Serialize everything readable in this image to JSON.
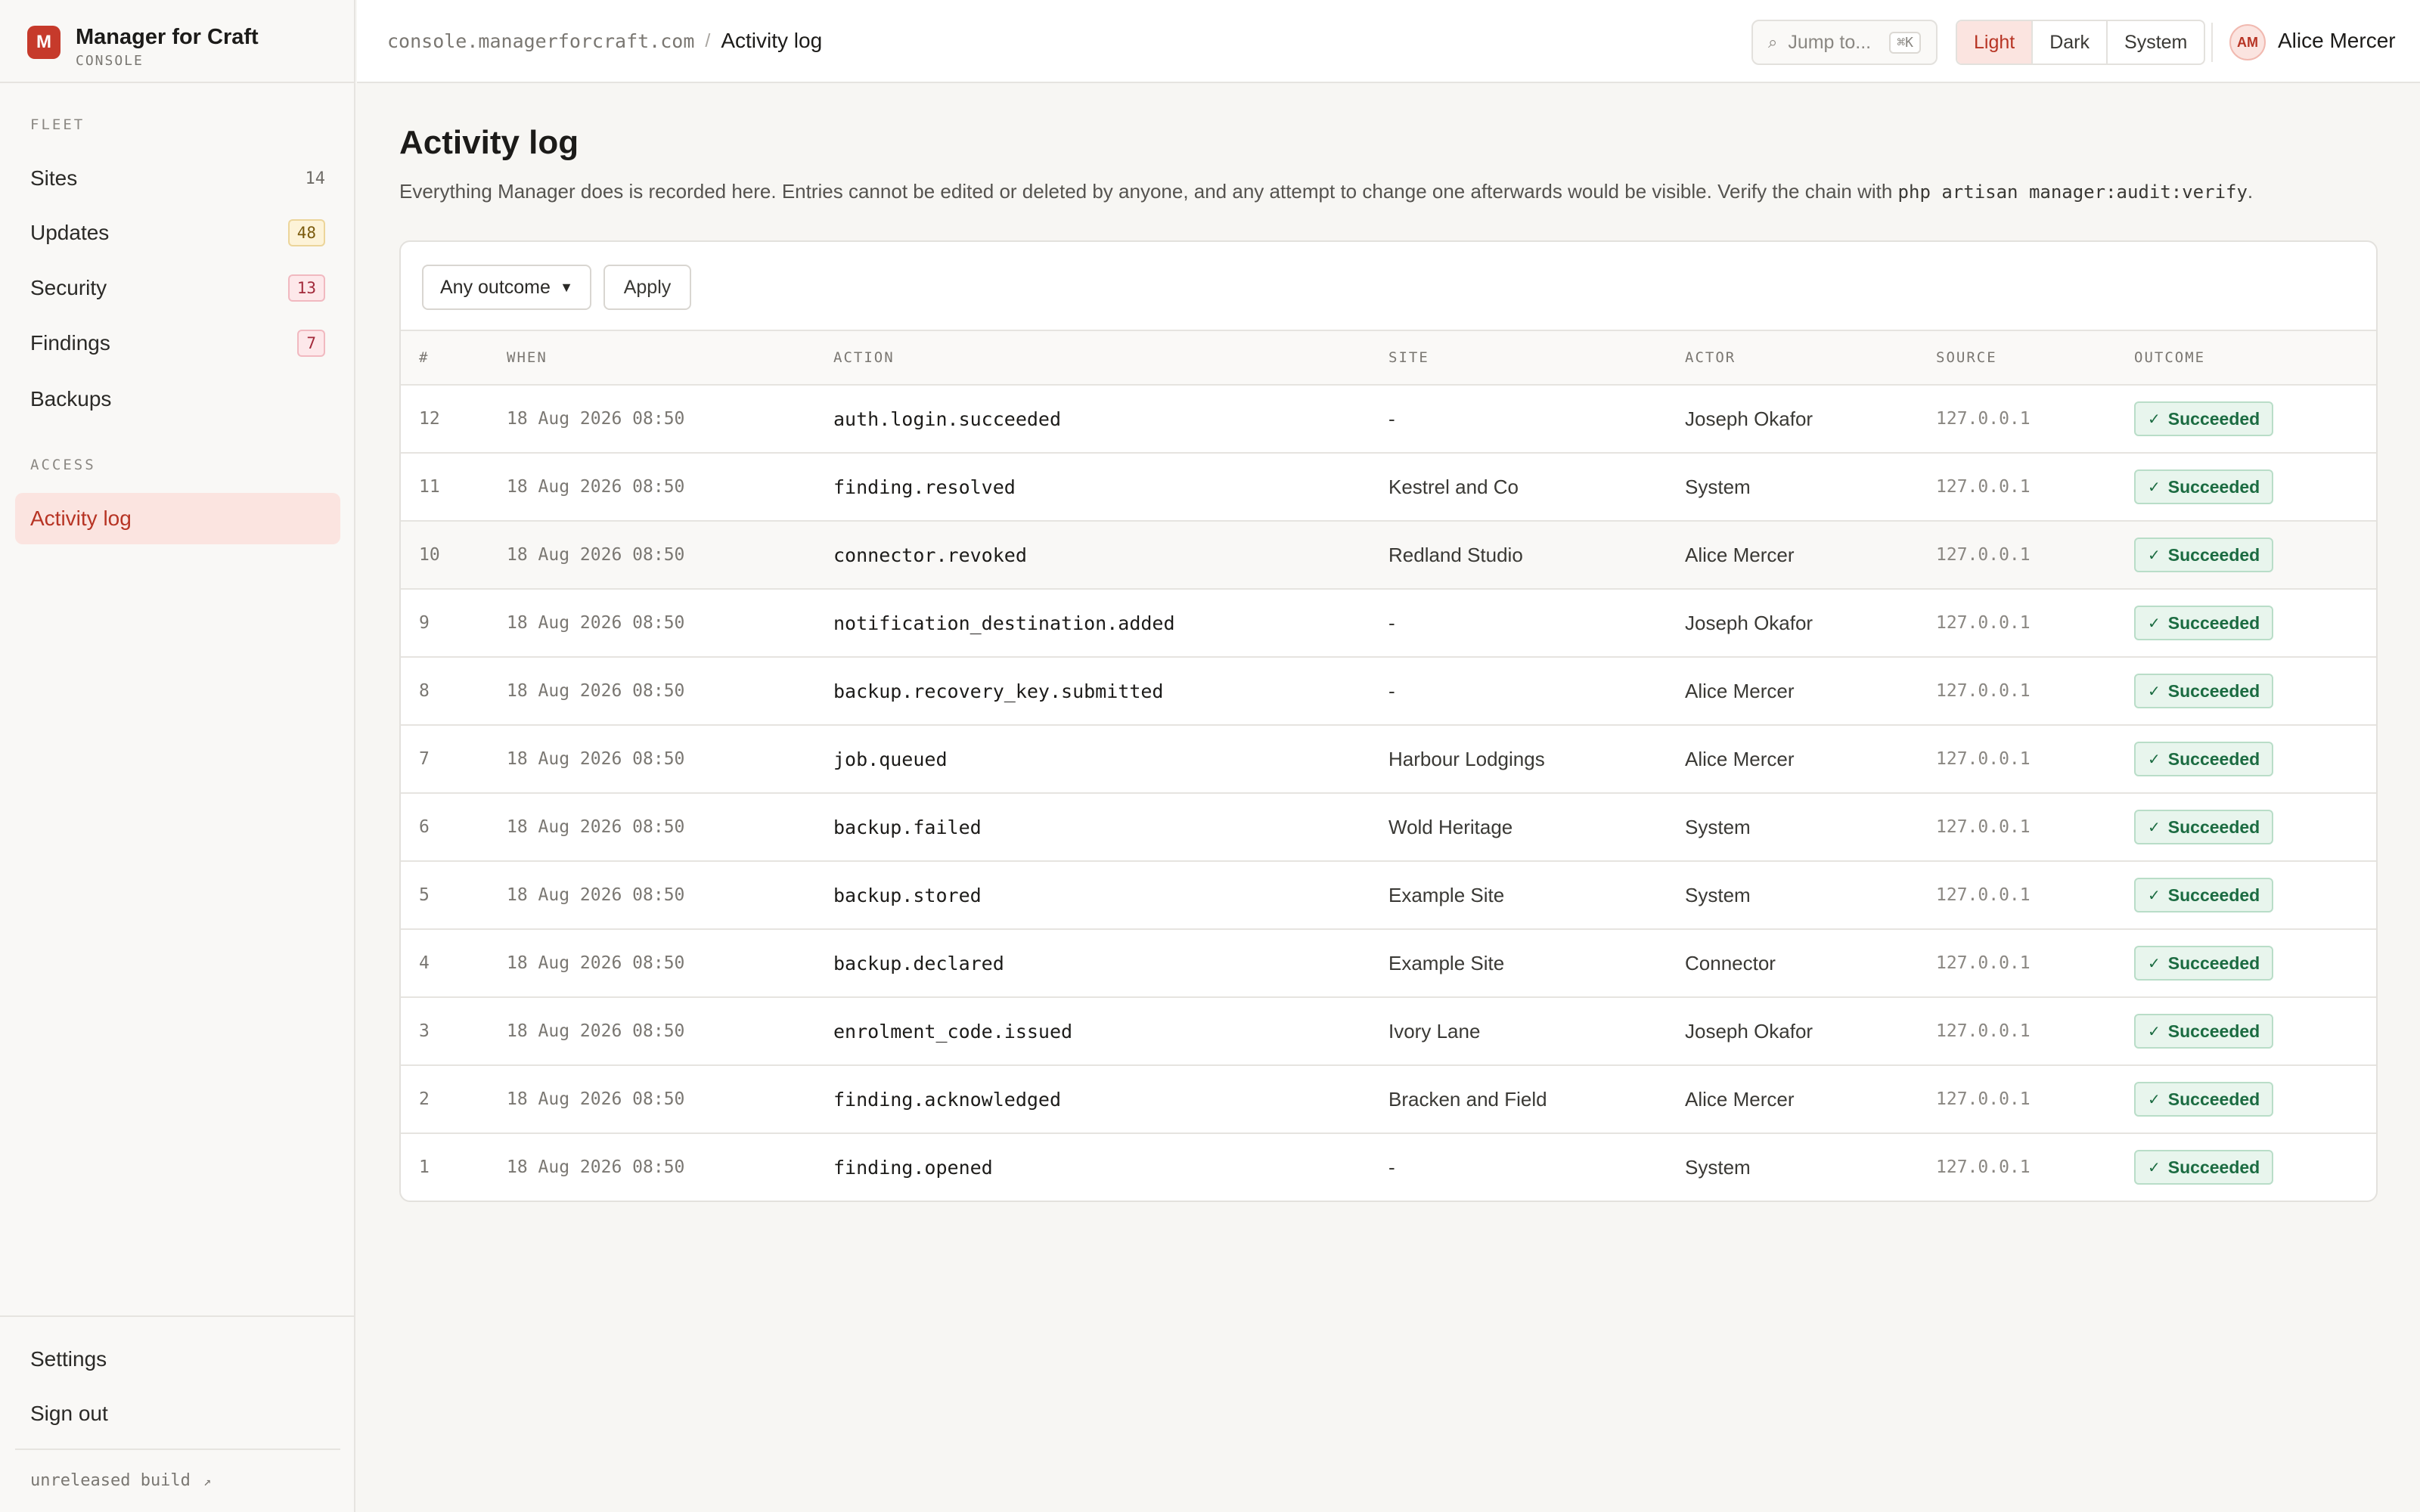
{
  "brand": {
    "logo_letter": "M",
    "name": "Manager for Craft",
    "sub": "CONSOLE"
  },
  "sidebar": {
    "fleet_label": "FLEET",
    "fleet_items": [
      {
        "label": "Sites",
        "count": "14",
        "badge": "plain"
      },
      {
        "label": "Updates",
        "count": "48",
        "badge": "amber"
      },
      {
        "label": "Security",
        "count": "13",
        "badge": "rose"
      },
      {
        "label": "Findings",
        "count": "7",
        "badge": "rose"
      },
      {
        "label": "Backups",
        "count": "",
        "badge": "none"
      }
    ],
    "access_label": "ACCESS",
    "access_items": [
      {
        "label": "Activity log",
        "active": true
      }
    ],
    "bottom_items": [
      {
        "label": "Settings"
      },
      {
        "label": "Sign out"
      }
    ],
    "build_label": "unreleased build",
    "build_icon": "external-link-icon"
  },
  "topbar": {
    "domain": "console.managerforcraft.com",
    "separator": "/",
    "current": "Activity log",
    "jump_placeholder": "Jump to...",
    "jump_shortcut": "⌘K",
    "theme_options": [
      "Light",
      "Dark",
      "System"
    ],
    "theme_selected": "Light",
    "user_initials": "AM",
    "user_name": "Alice Mercer"
  },
  "main": {
    "title": "Activity log",
    "description_text": "Everything Manager does is recorded here. Entries cannot be edited or deleted by anyone, and any attempt to change one afterwards would be visible. Verify the chain with ",
    "description_code": "php artisan manager:audit:verify",
    "description_end": ".",
    "filter": {
      "selected": "Any outcome",
      "apply_label": "Apply"
    },
    "columns": [
      "#",
      "WHEN",
      "ACTION",
      "SITE",
      "ACTOR",
      "SOURCE",
      "OUTCOME"
    ],
    "rows": [
      {
        "num": "12",
        "when": "18 Aug 2026 08:50",
        "action": "auth.login.succeeded",
        "site": "-",
        "actor": "Joseph Okafor",
        "source": "127.0.0.1",
        "outcome": "Succeeded"
      },
      {
        "num": "11",
        "when": "18 Aug 2026 08:50",
        "action": "finding.resolved",
        "site": "Kestrel and Co",
        "actor": "System",
        "source": "127.0.0.1",
        "outcome": "Succeeded"
      },
      {
        "num": "10",
        "when": "18 Aug 2026 08:50",
        "action": "connector.revoked",
        "site": "Redland Studio",
        "actor": "Alice Mercer",
        "source": "127.0.0.1",
        "outcome": "Succeeded"
      },
      {
        "num": "9",
        "when": "18 Aug 2026 08:50",
        "action": "notification_destination.added",
        "site": "-",
        "actor": "Joseph Okafor",
        "source": "127.0.0.1",
        "outcome": "Succeeded"
      },
      {
        "num": "8",
        "when": "18 Aug 2026 08:50",
        "action": "backup.recovery_key.submitted",
        "site": "-",
        "actor": "Alice Mercer",
        "source": "127.0.0.1",
        "outcome": "Succeeded"
      },
      {
        "num": "7",
        "when": "18 Aug 2026 08:50",
        "action": "job.queued",
        "site": "Harbour Lodgings",
        "actor": "Alice Mercer",
        "source": "127.0.0.1",
        "outcome": "Succeeded"
      },
      {
        "num": "6",
        "when": "18 Aug 2026 08:50",
        "action": "backup.failed",
        "site": "Wold Heritage",
        "actor": "System",
        "source": "127.0.0.1",
        "outcome": "Succeeded"
      },
      {
        "num": "5",
        "when": "18 Aug 2026 08:50",
        "action": "backup.stored",
        "site": "Example Site",
        "actor": "System",
        "source": "127.0.0.1",
        "outcome": "Succeeded"
      },
      {
        "num": "4",
        "when": "18 Aug 2026 08:50",
        "action": "backup.declared",
        "site": "Example Site",
        "actor": "Connector",
        "source": "127.0.0.1",
        "outcome": "Succeeded"
      },
      {
        "num": "3",
        "when": "18 Aug 2026 08:50",
        "action": "enrolment_code.issued",
        "site": "Ivory Lane",
        "actor": "Joseph Okafor",
        "source": "127.0.0.1",
        "outcome": "Succeeded"
      },
      {
        "num": "2",
        "when": "18 Aug 2026 08:50",
        "action": "finding.acknowledged",
        "site": "Bracken and Field",
        "actor": "Alice Mercer",
        "source": "127.0.0.1",
        "outcome": "Succeeded"
      },
      {
        "num": "1",
        "when": "18 Aug 2026 08:50",
        "action": "finding.opened",
        "site": "-",
        "actor": "System",
        "source": "127.0.0.1",
        "outcome": "Succeeded"
      }
    ]
  },
  "colors": {
    "accent": "#c63a2b",
    "success": "#1b6b41",
    "background": "#f7f6f3"
  }
}
